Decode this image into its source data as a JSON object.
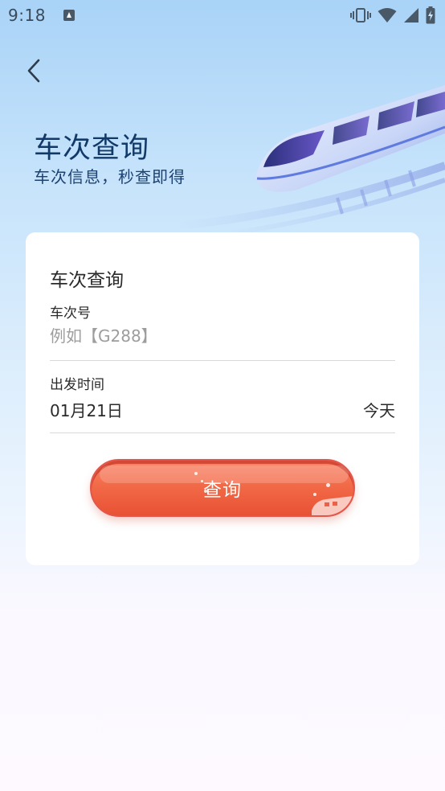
{
  "status_bar": {
    "time": "9:18",
    "icons": [
      "notification-a-icon",
      "vibrate-icon",
      "wifi-icon",
      "signal-icon",
      "battery-charging-icon"
    ]
  },
  "header": {
    "back_icon": "chevron-left-icon",
    "title": "车次查询",
    "subtitle": "车次信息，秒查即得"
  },
  "form": {
    "title": "车次查询",
    "train_number": {
      "label": "车次号",
      "value": "",
      "placeholder": "例如【G288】"
    },
    "departure": {
      "label": "出发时间",
      "date": "01月21日",
      "day_hint": "今天"
    },
    "submit_label": "查询"
  },
  "colors": {
    "title": "#123a68",
    "button": "#f26a48",
    "background_top": "#a9d3f7"
  }
}
